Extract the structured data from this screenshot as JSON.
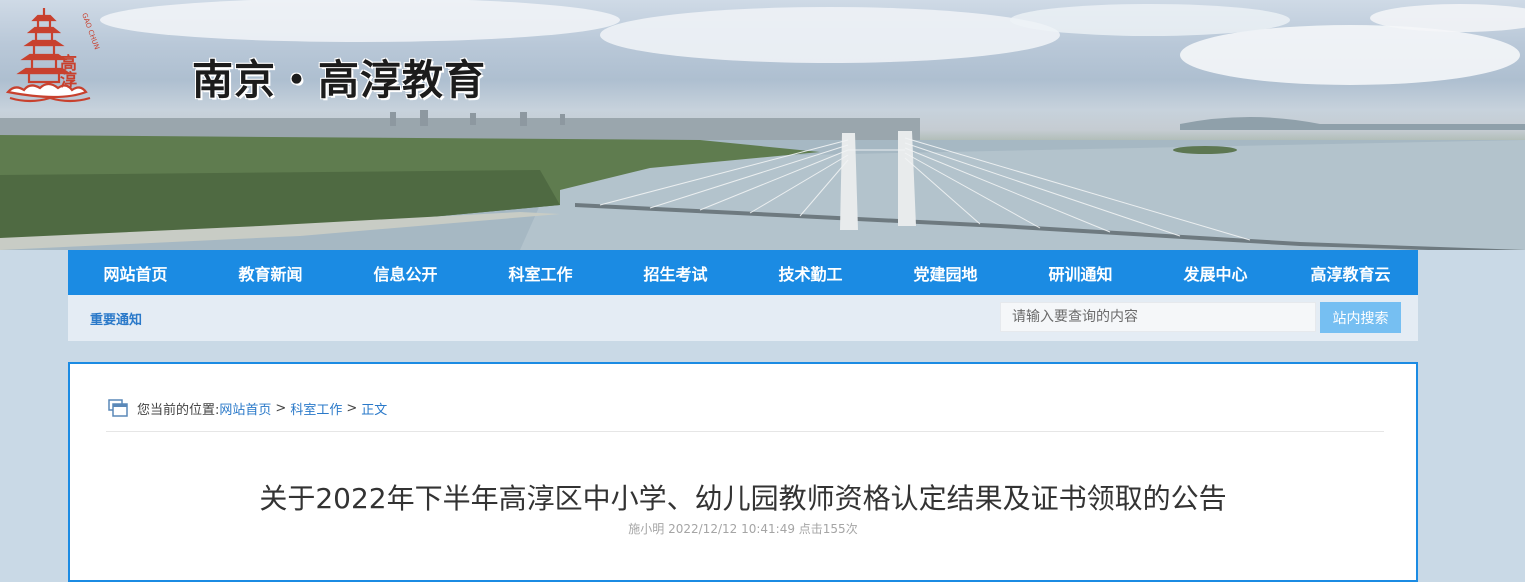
{
  "header": {
    "site_title": "南京・高淳教育",
    "logo_text": "高淳",
    "logo_arc_text": "GAO CHUN"
  },
  "nav": {
    "items": [
      {
        "label": "网站首页"
      },
      {
        "label": "教育新闻"
      },
      {
        "label": "信息公开"
      },
      {
        "label": "科室工作"
      },
      {
        "label": "招生考试"
      },
      {
        "label": "技术勤工"
      },
      {
        "label": "党建园地"
      },
      {
        "label": "研训通知"
      },
      {
        "label": "发展中心"
      },
      {
        "label": "高淳教育云"
      }
    ]
  },
  "notice": {
    "label": "重要通知"
  },
  "search": {
    "placeholder": "请输入要查询的内容",
    "value": "",
    "button_label": "站内搜索"
  },
  "breadcrumb": {
    "prefix": "您当前的位置:",
    "home": "网站首页",
    "section": "科室工作",
    "separator": ">",
    "current": "正文"
  },
  "article": {
    "title": "关于2022年下半年高淳区中小学、幼儿园教师资格认定结果及证书领取的公告",
    "meta": "施小明 2022/12/12 10:41:49 点击155次"
  },
  "colors": {
    "nav_bg": "#1b8be3",
    "accent_link": "#2a79c9",
    "search_button": "#76bff2",
    "logo_red": "#c8412e"
  },
  "icons": {
    "breadcrumb": "window-stack-icon"
  }
}
